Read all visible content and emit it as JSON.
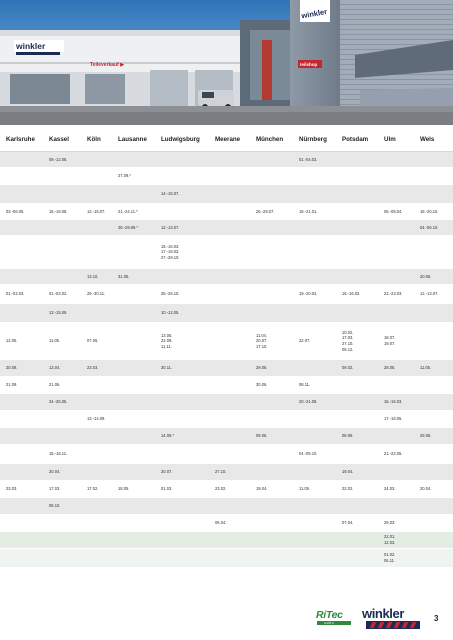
{
  "hero": {
    "sign_winkler": "winkler",
    "sign_teileverkauf": "Teileverkauf ▶",
    "sign_tower": "winkler",
    "sign_small": "teilshop"
  },
  "table": {
    "cities": [
      "Karlsruhe",
      "Kassel",
      "Köln",
      "Lausanne",
      "Ludwigsburg",
      "Meerane",
      "München",
      "Nürnberg",
      "Potsdam",
      "Ulm",
      "Wels"
    ],
    "rows": [
      {
        "shade": "g",
        "cells": [
          "",
          "09.-12.08.",
          "",
          "",
          "",
          "",
          "",
          "01.-04.03.",
          "",
          "",
          ""
        ]
      },
      {
        "shade": "w",
        "cells": [
          "",
          "",
          "",
          "27.09.*",
          "",
          "",
          "",
          "",
          "",
          "",
          ""
        ]
      },
      {
        "shade": "g",
        "cells": [
          "",
          "",
          "",
          "",
          "14.-15.07.",
          "",
          "",
          "",
          "",
          "",
          ""
        ]
      },
      {
        "shade": "w",
        "cells": [
          "03.-06.05.",
          "16.-18.08.",
          "12.-15.07.",
          "21.-24.11.*",
          "",
          "",
          "26.-29.07.",
          "18.-21.01.",
          "",
          "05.-08.04.",
          "18.-20.10."
        ]
      },
      {
        "shade": "g",
        "cells": [
          "",
          "",
          "",
          "28.-29.09.*",
          "12.-13.07.",
          "",
          "",
          "",
          "",
          "",
          "04.-06.10."
        ]
      },
      {
        "shade": "w",
        "cells": [
          "",
          "",
          "",
          "",
          "15.-16.03.\n17.-18.03.\n27.-28.10.",
          "",
          "",
          "",
          "",
          "",
          ""
        ]
      },
      {
        "shade": "g",
        "cells": [
          "",
          "",
          "13.10.",
          "31.05.",
          "",
          "",
          "",
          "",
          "",
          "",
          "20.06."
        ]
      },
      {
        "shade": "w",
        "cells": [
          "01.-02.03.",
          "01.-02.02.",
          "29.-30.11.",
          "",
          "25.-26.10.",
          "",
          "",
          "19.-20.04.",
          "15.-16.02.",
          "22.-23.03.",
          "12.-13.07."
        ]
      },
      {
        "shade": "g",
        "cells": [
          "",
          "13.-15.09.",
          "",
          "",
          "10.-12.05.",
          "",
          "",
          "",
          "",
          "",
          ""
        ]
      },
      {
        "shade": "w",
        "cells": [
          "12.05.",
          "11.05.",
          "07.06.",
          "",
          "13.05.\n22.09.\n11.11.",
          "",
          "11.04.\n20.07.\n17.10.",
          "22.07.",
          "10.02.\n17.03.\n27.10.\n08.12.",
          "18.07.\n19.07.",
          ""
        ]
      },
      {
        "shade": "g",
        "cells": [
          "20.09.",
          "13.04.",
          "23.03.",
          "",
          "30.11.",
          "",
          "29.06.",
          "",
          "09.02.",
          "28.05.",
          "11.05."
        ]
      },
      {
        "shade": "w",
        "cells": [
          "21.09.",
          "21.06.",
          "",
          "",
          "",
          "",
          "30.06.",
          "08.11.",
          "",
          "",
          ""
        ]
      },
      {
        "shade": "g",
        "cells": [
          "",
          "24.-25.05.",
          "",
          "",
          "",
          "",
          "",
          "20.-21.09.",
          "",
          "15.-16.03.",
          ""
        ]
      },
      {
        "shade": "w",
        "cells": [
          "",
          "",
          "13.-14.09.",
          "",
          "",
          "",
          "",
          "",
          "",
          "17.-18.05.",
          ""
        ]
      },
      {
        "shade": "g",
        "cells": [
          "",
          "",
          "",
          "",
          "14.09.*",
          "",
          "09.06.",
          "",
          "08.06.",
          "",
          "29.06."
        ]
      },
      {
        "shade": "w",
        "cells": [
          "",
          "15.-16.11.",
          "",
          "",
          "",
          "",
          "",
          "04.-05.10.",
          "",
          "21.-22.06.",
          ""
        ]
      },
      {
        "shade": "g",
        "cells": [
          "",
          "20.04.",
          "",
          "",
          "20.07.",
          "27.10.",
          "",
          "",
          "19.04.",
          "",
          ""
        ]
      },
      {
        "shade": "w",
        "cells": [
          "23.03.",
          "17.03.",
          "17.02.",
          "18.05.",
          "01.03.",
          "23.02.",
          "19.04.",
          "11.05.",
          "22.02.",
          "24.03.",
          "20.04."
        ]
      },
      {
        "shade": "g",
        "cells": [
          "",
          "05.10.",
          "",
          "",
          "",
          "",
          "",
          "",
          "",
          "",
          ""
        ]
      },
      {
        "shade": "w",
        "cells": [
          "",
          "",
          "",
          "",
          "",
          "05.04.",
          "",
          "",
          "07.04.",
          "29.03.",
          ""
        ]
      },
      {
        "shade": "gr",
        "cells": [
          "",
          "",
          "",
          "",
          "",
          "",
          "",
          "",
          "",
          "22.01.\n12.03.",
          ""
        ]
      },
      {
        "shade": "lg",
        "cells": [
          "",
          "",
          "",
          "",
          "",
          "",
          "",
          "",
          "",
          "01.02.\n06.11.",
          ""
        ]
      }
    ]
  },
  "footer": {
    "ritec": "RiTec",
    "ritec_sub": "GMBH",
    "winkler": "winkler",
    "page_number": "3"
  },
  "colors": {
    "winkler_blue": "#1b2a55",
    "winkler_red": "#c4262e",
    "ritec_green": "#2f8a3c",
    "row_gray": "#e8e8e8"
  }
}
